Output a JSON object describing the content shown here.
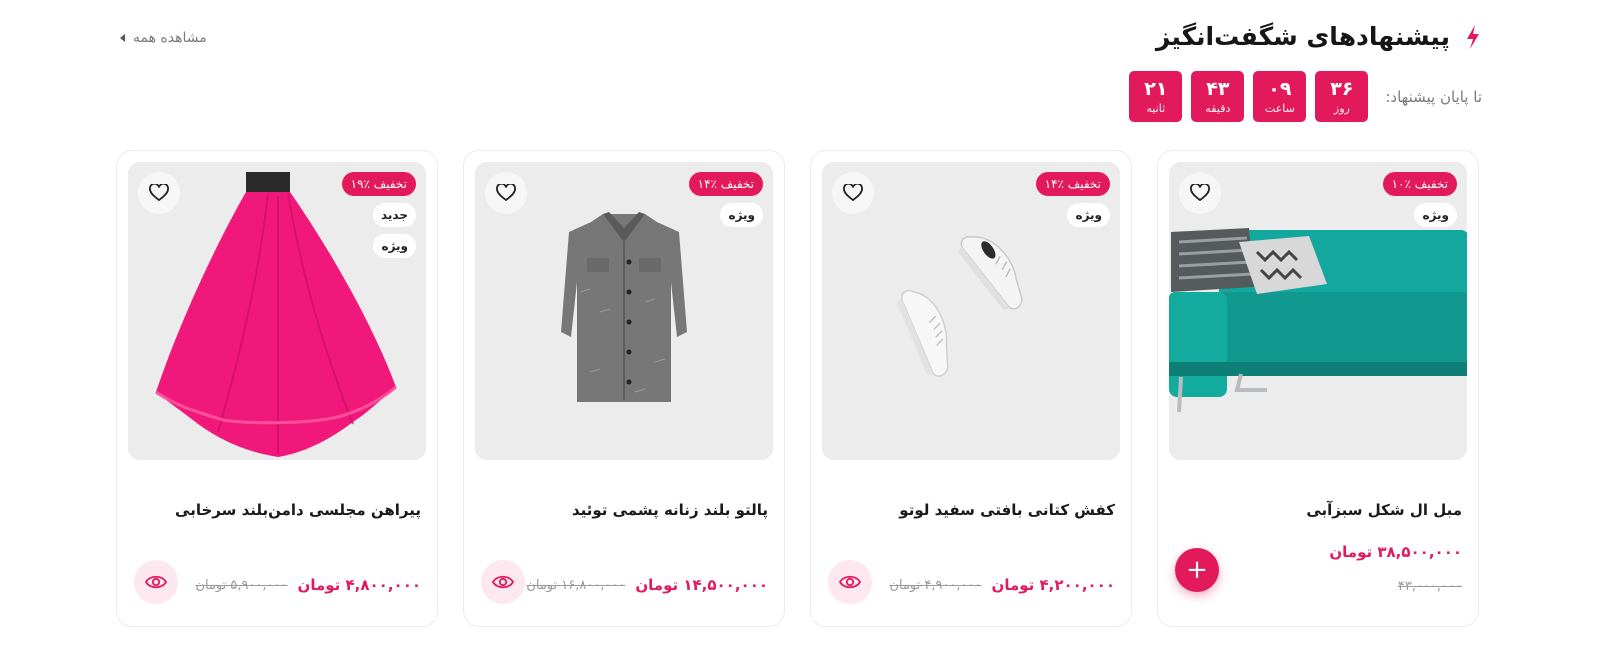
{
  "header": {
    "title": "پیشنهادهای شگفت‌انگیز",
    "view_all": "مشاهده همه",
    "accent": "#e2195b"
  },
  "countdown": {
    "label": "تا پایان پیشنهاد:",
    "units": [
      {
        "value": "۳۶",
        "unit": "روز"
      },
      {
        "value": "۰۹",
        "unit": "ساعت"
      },
      {
        "value": "۴۳",
        "unit": "دقیقه"
      },
      {
        "value": "۲۱",
        "unit": "ثانیه"
      }
    ]
  },
  "products": [
    {
      "name": "مبل ال شکل سبزآبی",
      "discount": "۱۰٪ تخفیف",
      "tags": [
        "ویژه"
      ],
      "price": "۳۸,۵۰۰,۰۰۰ تومان",
      "old_price": "۴۳,۰۰۰,۰۰۰",
      "action": "add-to-cart",
      "add_symbol": "+",
      "image": "sofa"
    },
    {
      "name": "کفش کتانی بافتی سفید لوتو",
      "discount": "۱۴٪ تخفیف",
      "tags": [
        "ویژه"
      ],
      "price": "۴,۲۰۰,۰۰۰ تومان",
      "old_price": "۴,۹۰۰,۰۰۰ تومان",
      "action": "quick-view",
      "image": "sneakers"
    },
    {
      "name": "پالتو بلند زنانه پشمی توئید",
      "discount": "۱۴٪ تخفیف",
      "tags": [
        "ویژه"
      ],
      "price": "۱۴,۵۰۰,۰۰۰ تومان",
      "old_price": "۱۶,۸۰۰,۰۰۰ تومان",
      "action": "quick-view",
      "image": "coat"
    },
    {
      "name": "پیراهن مجلسی دامن‌بلند سرخابی",
      "discount": "۱۹٪ تخفیف",
      "tags": [
        "جدید",
        "ویژه"
      ],
      "price": "۴,۸۰۰,۰۰۰ تومان",
      "old_price": "۵,۹۰۰,۰۰۰ تومان",
      "action": "quick-view",
      "image": "dress"
    }
  ]
}
